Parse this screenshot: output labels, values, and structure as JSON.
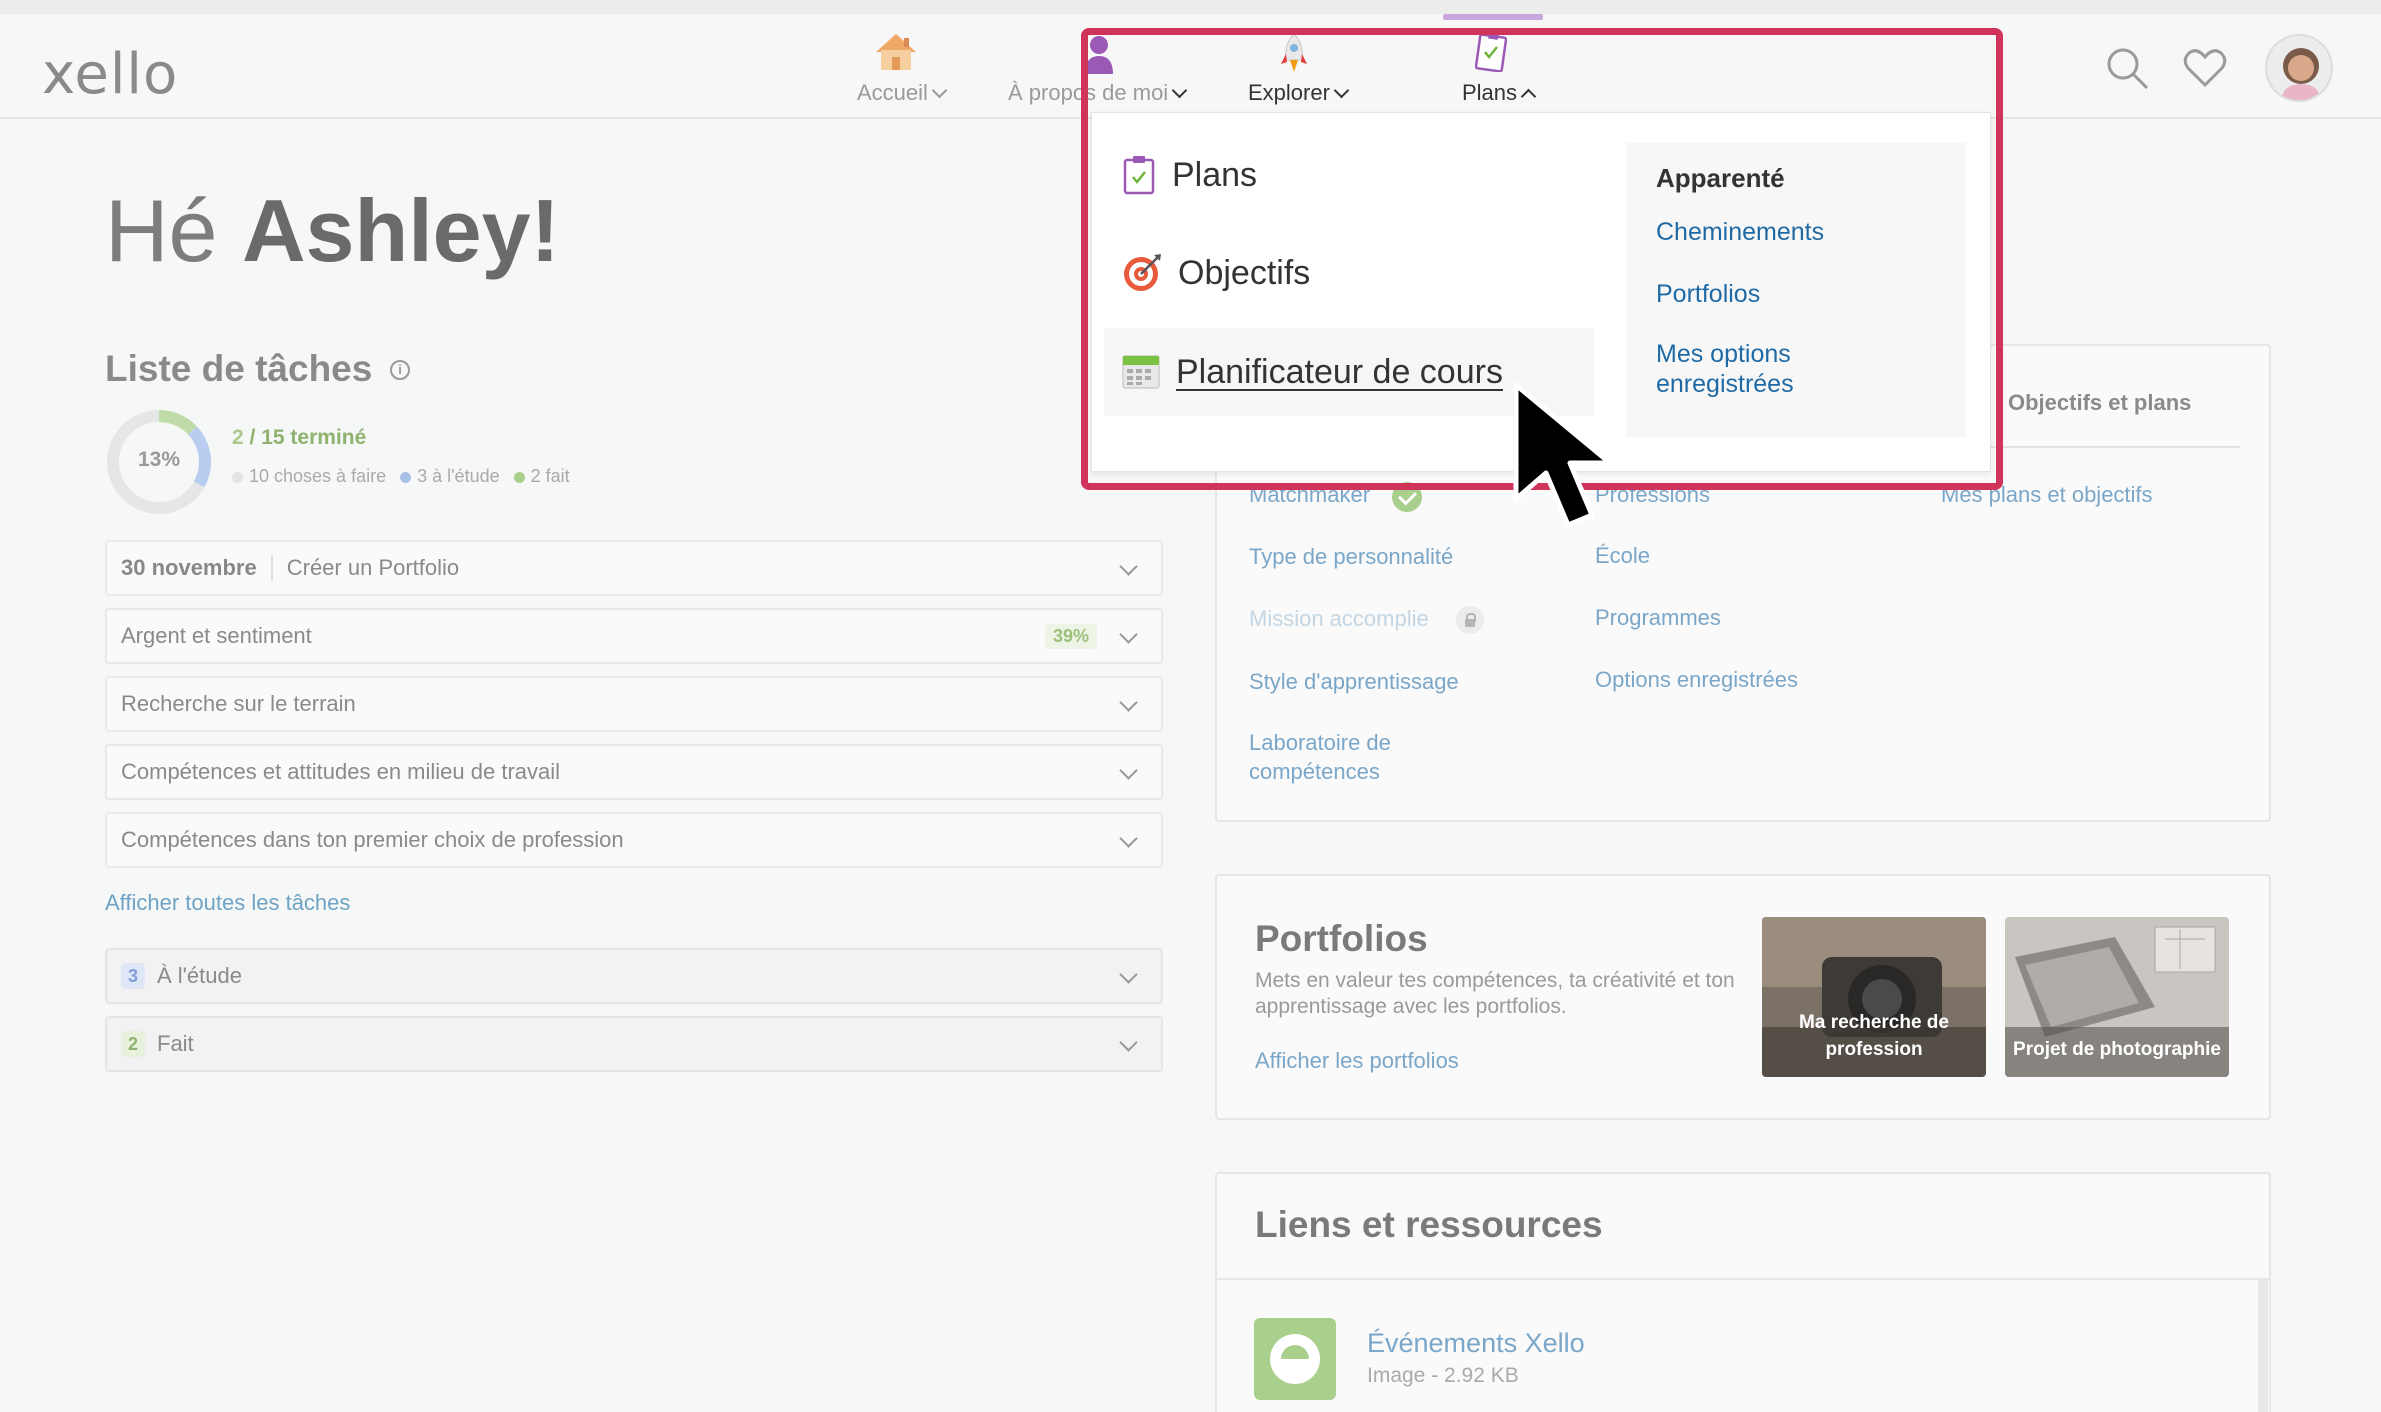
{
  "header": {
    "logo": "xello",
    "nav": [
      {
        "label": "Accueil",
        "icon": "house-icon"
      },
      {
        "label": "À propos de moi",
        "icon": "person-icon"
      },
      {
        "label": "Explorer",
        "icon": "rocket-icon"
      },
      {
        "label": "Plans",
        "icon": "clipboard-icon"
      }
    ]
  },
  "greeting": {
    "prefix": "Hé",
    "name": "Ashley!"
  },
  "tasks": {
    "title": "Liste de tâches",
    "percent": "13%",
    "percent_value": 0.13,
    "done_count": "2",
    "total_label": "/ 15 terminé",
    "legend": [
      {
        "label": "10 choses à faire",
        "color": "#e3e3e3"
      },
      {
        "label": "3 à l'étude",
        "color": "#a8bfe6"
      },
      {
        "label": "2 fait",
        "color": "#a9cf8d"
      }
    ],
    "rows": [
      {
        "date": "30 novembre",
        "label": "Créer un Portfolio"
      },
      {
        "label": "Argent et sentiment",
        "pct": "39%"
      },
      {
        "label": "Recherche sur le terrain"
      },
      {
        "label": "Compétences et attitudes en milieu de travail"
      },
      {
        "label": "Compétences dans ton premier choix de profession"
      }
    ],
    "show_all": "Afficher toutes les tâches",
    "groups": [
      {
        "count": "3",
        "label": "À l'étude",
        "badge_color": "#dfe7f6",
        "text_color": "#7f9fd6"
      },
      {
        "count": "2",
        "label": "Fait",
        "badge_color": "#e7f1de",
        "text_color": "#8fb26f"
      }
    ]
  },
  "about_card": {
    "goals_tab": "Objectifs et plans",
    "col1": [
      "Matchmaker",
      "Type de personnalité",
      "Mission accomplie",
      "Style d'apprentissage",
      "Laboratoire de compétences"
    ],
    "col2": [
      "Professions",
      "École",
      "Programmes",
      "Options enregistrées"
    ],
    "col3": [
      "Mes plans et objectifs"
    ]
  },
  "portfolios": {
    "title": "Portfolios",
    "description": "Mets en valeur tes compétences, ta créativité et ton apprentissage avec les portfolios.",
    "link": "Afficher les portfolios",
    "thumbs": [
      "Ma recherche de profession",
      "Projet de photographie"
    ]
  },
  "resources": {
    "title": "Liens et ressources",
    "item_name": "Événements Xello",
    "item_meta": "Image - 2.92 KB"
  },
  "dropdown": {
    "items": [
      {
        "label": "Plans",
        "icon": "clipboard-icon"
      },
      {
        "label": "Objectifs",
        "icon": "target-icon"
      },
      {
        "label": "Planificateur de cours",
        "icon": "calendar-icon"
      }
    ],
    "related_title": "Apparenté",
    "related_links": [
      "Cheminements",
      "Portfolios",
      "Mes options enregistrées"
    ]
  },
  "colors": {
    "highlight": "#d1345b",
    "link": "#1f6aa5",
    "done_green": "#a9cf8d",
    "study_blue": "#a8bfe6"
  }
}
